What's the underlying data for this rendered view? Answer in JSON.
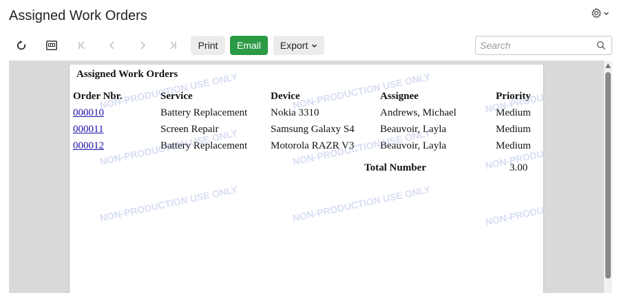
{
  "window": {
    "title": "Assigned Work Orders"
  },
  "header": {
    "settings_icon": "gear-icon",
    "settings_chevron": "chevron-down-icon"
  },
  "toolbar": {
    "refresh_icon": "refresh-icon",
    "pdf_icon": "pdf-icon",
    "first_icon": "first-page-icon",
    "prev_icon": "previous-page-icon",
    "next_icon": "next-page-icon",
    "last_icon": "last-page-icon",
    "print_label": "Print",
    "email_label": "Email",
    "export_label": "Export",
    "search_placeholder": "Search",
    "search_value": "",
    "accent_color": "#2b9a45"
  },
  "report": {
    "title": "Assigned Work Orders",
    "columns": [
      "Order Nbr.",
      "Service",
      "Device",
      "Assignee",
      "Priority"
    ],
    "rows": [
      [
        "000010",
        "Battery Replacement",
        "Nokia 3310",
        "Andrews, Michael",
        "Medium"
      ],
      [
        "000011",
        "Screen Repair",
        "Samsung Galaxy S4",
        "Beauvoir, Layla",
        "Medium"
      ],
      [
        "000012",
        "Battery Replacement",
        "Motorola RAZR V3",
        "Beauvoir, Layla",
        "Medium"
      ]
    ],
    "total_label": "Total Number",
    "total_value": "3.00",
    "watermark": "NON-PRODUCTION USE ONLY",
    "watermark_partial": "NON-PRODU"
  }
}
